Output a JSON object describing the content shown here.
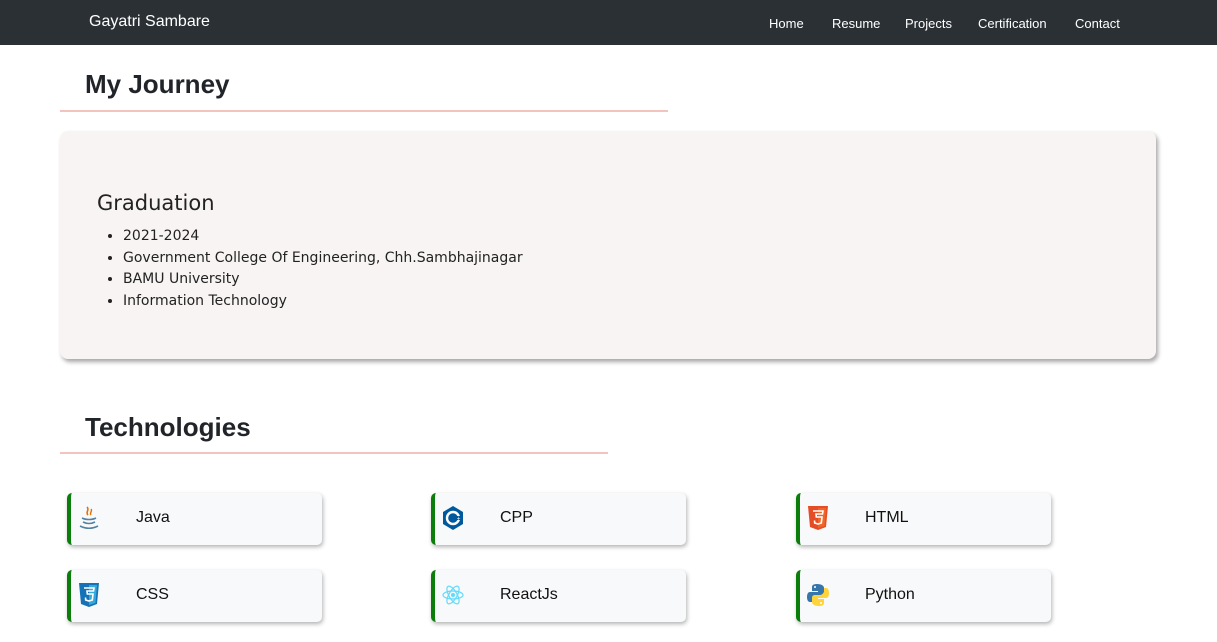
{
  "navbar": {
    "brand": "Gayatri Sambare",
    "links": [
      "Home",
      "Resume",
      "Projects",
      "Certification",
      "Contact"
    ]
  },
  "journey": {
    "title": "My Journey",
    "card": {
      "heading": "Graduation",
      "items": [
        "2021-2024",
        "Government College Of Engineering, Chh.Sambhajinagar",
        "BAMU University",
        "Information Technology"
      ]
    }
  },
  "technologies": {
    "title": "Technologies",
    "items": [
      {
        "label": "Java",
        "icon": "java-icon"
      },
      {
        "label": "CPP",
        "icon": "cpp-icon"
      },
      {
        "label": "HTML",
        "icon": "html5-icon"
      },
      {
        "label": "CSS",
        "icon": "css3-icon"
      },
      {
        "label": "ReactJs",
        "icon": "react-icon"
      },
      {
        "label": "Python",
        "icon": "python-icon"
      }
    ]
  },
  "colors": {
    "navbar_bg": "#2b3035",
    "title_rule": "#f3c3bd",
    "card_bg": "#f8f4f3",
    "tech_accent": "#0a7d0a"
  }
}
